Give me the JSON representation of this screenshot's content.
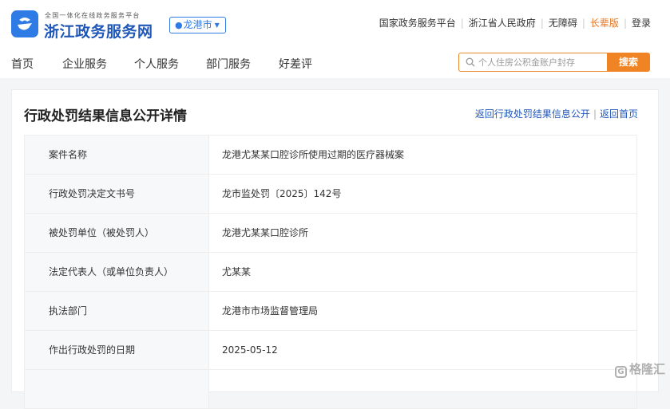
{
  "header": {
    "brand_small": "全国一体化在线政务服务平台",
    "brand_big": "浙江政务服务网",
    "city": "龙港市",
    "top_links": [
      "国家政务服务平台",
      "浙江省人民政府",
      "无障碍",
      "长辈版",
      "登录"
    ]
  },
  "nav": {
    "items": [
      "首页",
      "企业服务",
      "个人服务",
      "部门服务",
      "好差评"
    ]
  },
  "search": {
    "placeholder": "个人住房公积金账户封存",
    "button": "搜索"
  },
  "page": {
    "title": "行政处罚结果信息公开详情",
    "back_link": "返回行政处罚结果信息公开",
    "home_link": "返回首页"
  },
  "table": {
    "rows": [
      {
        "label": "案件名称",
        "value": "龙港尤某某口腔诊所使用过期的医疗器械案"
      },
      {
        "label": "行政处罚决定文书号",
        "value": "龙市监处罚〔2025〕142号"
      },
      {
        "label": "被处罚单位（被处罚人）",
        "value": "龙港尤某某口腔诊所"
      },
      {
        "label": "法定代表人（或单位负责人）",
        "value": "尤某某"
      },
      {
        "label": "执法部门",
        "value": "龙港市市场监督管理局"
      },
      {
        "label": "作出行政处罚的日期",
        "value": "2025-05-12"
      },
      {
        "label": "",
        "value": ""
      }
    ]
  },
  "watermark": "格隆汇",
  "colors": {
    "primary": "#2e7be6",
    "brand_text": "#1f57b8",
    "accent": "#f08425"
  }
}
